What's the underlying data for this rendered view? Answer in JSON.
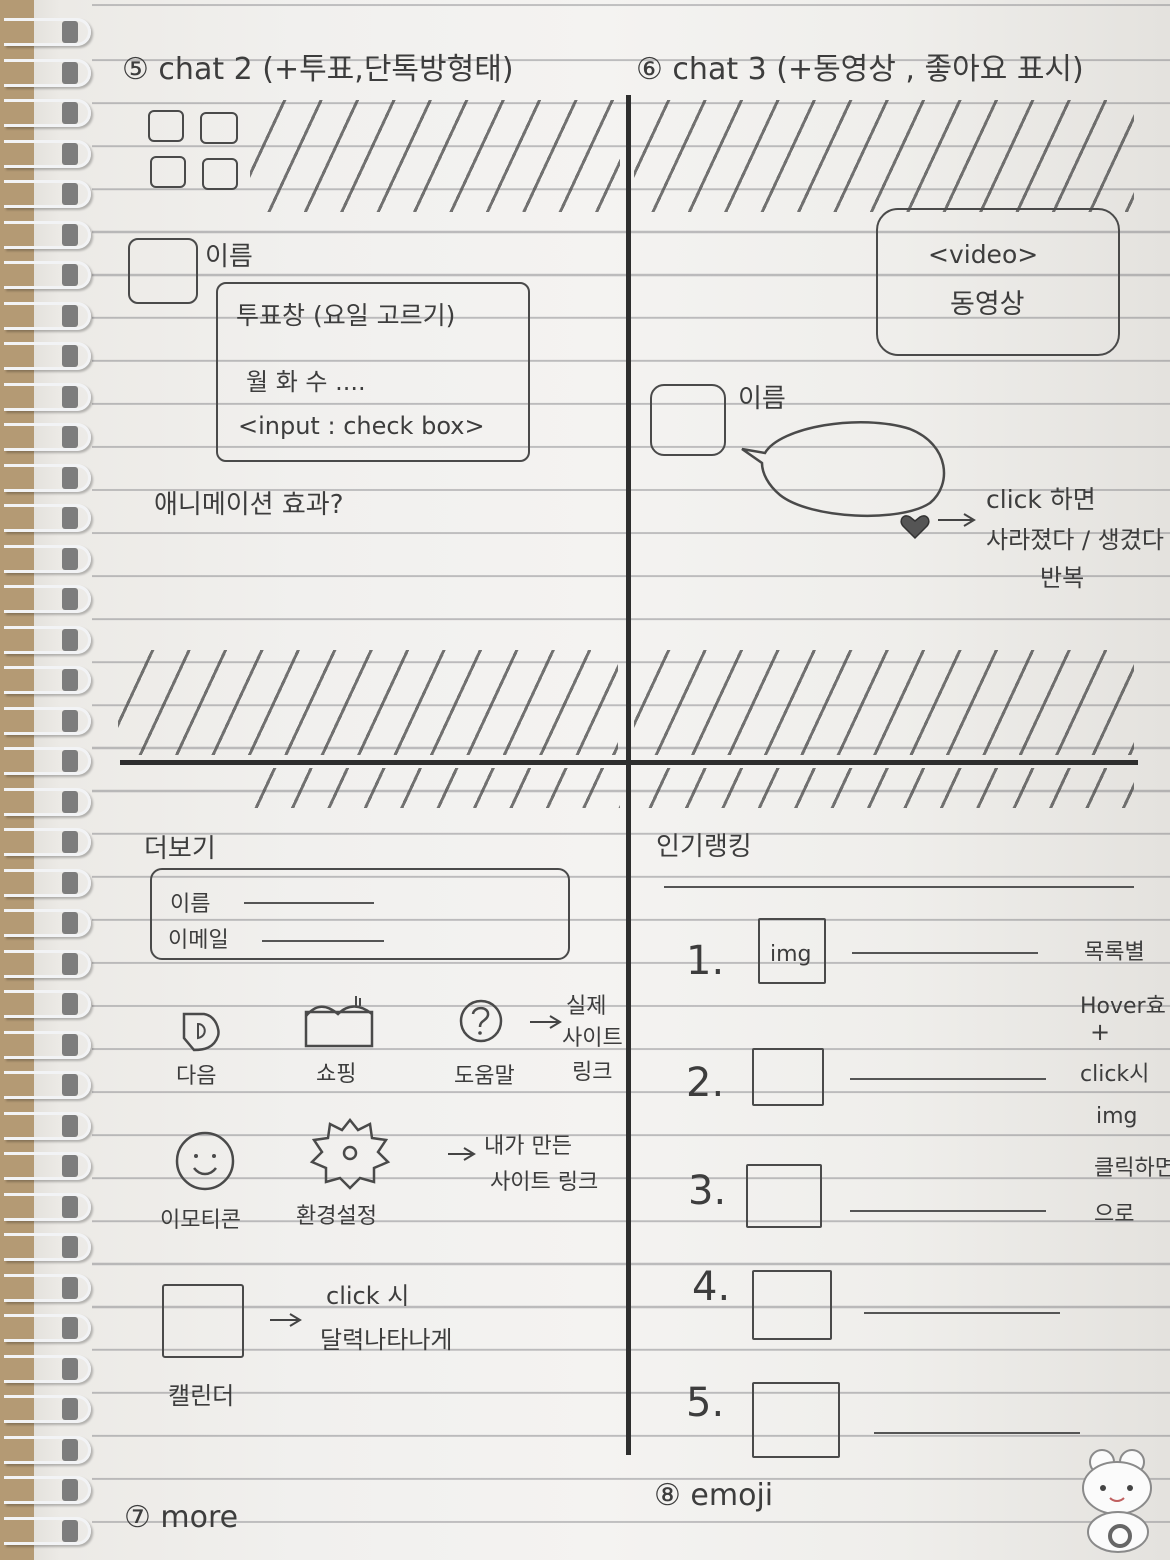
{
  "top_left": {
    "title": "⑤ chat 2 (+투표,단톡방형태)",
    "name_label": "이름",
    "poll": {
      "title": "투표창 (요일 고르기)",
      "options": "월  화  수 ....",
      "input": "<input : check box>"
    },
    "note": "애니메이션 효과?"
  },
  "top_right": {
    "title": "⑥ chat 3 (+동영상 , 좋아요 표시)",
    "video_tag": "<video>",
    "video_label": "동영상",
    "name_label": "이름",
    "click_note_1": "click 하면",
    "click_note_2": "사라졌다 / 생겼다",
    "click_note_3": "반복"
  },
  "bottom_left": {
    "heading": "더보기",
    "form": {
      "name_label": "이름",
      "email_label": "이메일"
    },
    "icons": [
      {
        "label": "다음",
        "icon": "tag-icon"
      },
      {
        "label": "쇼핑",
        "icon": "shopping-icon"
      },
      {
        "label": "도움말",
        "icon": "help-icon"
      },
      {
        "label": "이모티콘",
        "icon": "smiley-icon"
      },
      {
        "label": "환경설정",
        "icon": "gear-icon"
      }
    ],
    "help_note": [
      "실제",
      "사이트",
      "링크"
    ],
    "settings_note": [
      "내가 만든",
      "사이트 링크"
    ],
    "calendar_label": "캘린더",
    "calendar_note_1": "click 시",
    "calendar_note_2": "달력나타나게",
    "footer": "⑦ more"
  },
  "bottom_right": {
    "heading": "인기랭킹",
    "ranks": [
      "1.",
      "2.",
      "3.",
      "4.",
      "5."
    ],
    "first_thumb": "img",
    "side_note": [
      "목록별",
      "Hover효",
      "+",
      "click시",
      "img",
      "클릭하면",
      "으로"
    ],
    "footer": "⑧ emoji"
  }
}
